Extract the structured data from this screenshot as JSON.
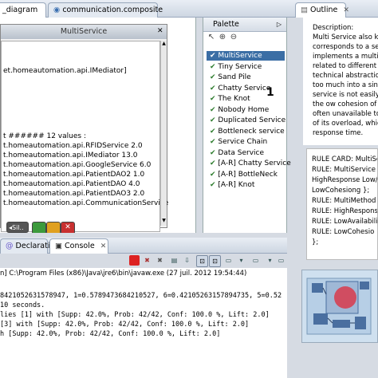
{
  "editor_tabs": [
    {
      "label": "_diagram",
      "active": true
    },
    {
      "label": "communication.composite",
      "active": false
    }
  ],
  "multiservice_window": {
    "title": "MultiService",
    "lines": [
      "et.homeautomation.api.IMediator]",
      "t  ###### 12 values :",
      "t.homeautomation.api.RFIDService 2.0",
      "t.homeautomation.api.IMediator 13.0",
      "t.homeautomation.api.GoogleService 6.0",
      "t.homeautomation.api.PatientDAO2 1.0",
      "t.homeautomation.api.PatientDAO 4.0",
      "t.homeautomation.api.PatientDAO3 2.0",
      "t.homeautomation.api.CommunicationService"
    ],
    "bar_label": "Sil.."
  },
  "palette": {
    "title": "Palette",
    "items": [
      "MultiService",
      "Tiny Service",
      "Sand Pile",
      "Chatty Service",
      "The Knot",
      "Nobody Home",
      "Duplicated Service",
      "Bottleneck service",
      "Service Chain",
      "Data Service",
      "[A-R] Chatty Service",
      "[A-R] BottleNeck",
      "[A-R] Knot"
    ],
    "selected_index": 0,
    "badge": "1"
  },
  "outline": {
    "tab_label": "Outline",
    "description": [
      "Description:",
      "Multi Service also kno",
      "corresponds to a serv",
      "implements a multitu",
      "related to different bu",
      "technical abstraction",
      "too much into a single",
      "service is not easily r",
      "the ow cohesion of it",
      "often unavailable to e",
      "of its overload, which",
      "response time."
    ],
    "rules": [
      "RULE CARD: MultiSe",
      "  RULE: MultiService {",
      "  HighResponse Low/",
      "  LowCohesiong };",
      "  RULE: MultiMethod {",
      "  RULE: HighRespons",
      "  RULE: LowAvailabili",
      "  RULE: LowCohesio",
      "};"
    ]
  },
  "bottom_tabs": [
    {
      "label": "Declaration",
      "active": false
    },
    {
      "label": "Console",
      "active": true
    }
  ],
  "console": {
    "header": "n] C:\\Program Files (x86)\\Java\\jre6\\bin\\javaw.exe (27 juil. 2012 19:54:44)",
    "lines": [
      "84210526315789​47, 1=0.5789473684210527, 6=0.42105263157894735, 5=0.52",
      "10 seconds.",
      "lies [1] with [Supp: 42.0%, Prob: 42/42, Conf: 100.0 %, Lift: 2.0]",
      " [3] with [Supp: 42.0%, Prob: 42/42, Conf: 100.0 %, Lift: 2.0]",
      "h [Supp: 42.0%, Prob: 42/42, Conf: 100.0 %, Lift: 2.0]"
    ]
  },
  "colors": {
    "selected": "#3b6ea5",
    "check": "#2f7d2f"
  }
}
